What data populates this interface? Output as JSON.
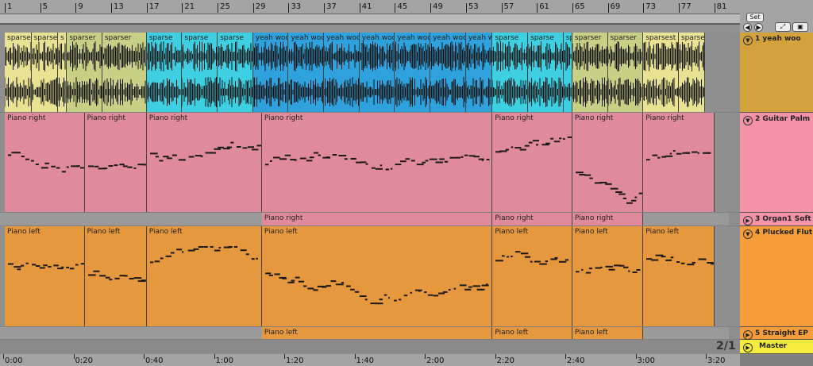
{
  "ruler": {
    "bars": [
      "1",
      "5",
      "9",
      "13",
      "17",
      "21",
      "25",
      "29",
      "33",
      "37",
      "41",
      "45",
      "49",
      "53",
      "57",
      "61",
      "65",
      "69",
      "73",
      "77",
      "81"
    ]
  },
  "set_button": "Set",
  "tracks": [
    {
      "number": "1",
      "name": "yeah woo",
      "color": "#d4a23a",
      "clips": [
        {
          "label": "sparsest",
          "color": "#e9e293",
          "start": 0,
          "end": 3
        },
        {
          "label": "sparsest",
          "color": "#e9e293",
          "start": 3,
          "end": 6
        },
        {
          "label": "s",
          "color": "#e9e293",
          "start": 6,
          "end": 7
        },
        {
          "label": "sparser",
          "color": "#c8d086",
          "start": 7,
          "end": 11
        },
        {
          "label": "sparser",
          "color": "#c8d086",
          "start": 11,
          "end": 16
        },
        {
          "label": "sparse",
          "color": "#3ed0e2",
          "start": 16,
          "end": 20
        },
        {
          "label": "sparse",
          "color": "#3ed0e2",
          "start": 20,
          "end": 24
        },
        {
          "label": "sparse",
          "color": "#3ed0e2",
          "start": 24,
          "end": 28
        },
        {
          "label": "yeah woo",
          "color": "#2fa2dd",
          "start": 28,
          "end": 32
        },
        {
          "label": "yeah woo",
          "color": "#2fa2dd",
          "start": 32,
          "end": 36
        },
        {
          "label": "yeah woo",
          "color": "#2fa2dd",
          "start": 36,
          "end": 40
        },
        {
          "label": "yeah woo",
          "color": "#2fa2dd",
          "start": 40,
          "end": 44
        },
        {
          "label": "yeah woo",
          "color": "#2fa2dd",
          "start": 44,
          "end": 48
        },
        {
          "label": "yeah woo",
          "color": "#2fa2dd",
          "start": 48,
          "end": 52
        },
        {
          "label": "yeah wo",
          "color": "#2fa2dd",
          "start": 52,
          "end": 55
        },
        {
          "label": "sparse",
          "color": "#3ed0e2",
          "start": 55,
          "end": 59
        },
        {
          "label": "sparse",
          "color": "#3ed0e2",
          "start": 59,
          "end": 63
        },
        {
          "label": "sp",
          "color": "#3ed0e2",
          "start": 63,
          "end": 64
        },
        {
          "label": "sparser",
          "color": "#c8d086",
          "start": 64,
          "end": 68
        },
        {
          "label": "sparser",
          "color": "#c8d086",
          "start": 68,
          "end": 72
        },
        {
          "label": "sparsest",
          "color": "#e9e293",
          "start": 72,
          "end": 76
        },
        {
          "label": "sparses",
          "color": "#e9e293",
          "start": 76,
          "end": 79
        }
      ]
    },
    {
      "number": "2",
      "name": "Guitar Palm",
      "color": "#f493a8",
      "clips": [
        {
          "label": "Piano right",
          "color": "#e08b9c",
          "start": 0,
          "end": 9
        },
        {
          "label": "Piano right",
          "color": "#e08b9c",
          "start": 9,
          "end": 16
        },
        {
          "label": "Piano right",
          "color": "#e08b9c",
          "start": 16,
          "end": 29
        },
        {
          "label": "Piano right",
          "color": "#e08b9c",
          "start": 29,
          "end": 55
        },
        {
          "label": "Piano right",
          "color": "#e08b9c",
          "start": 55,
          "end": 64
        },
        {
          "label": "Piano right",
          "color": "#e08b9c",
          "start": 64,
          "end": 72
        },
        {
          "label": "Piano right",
          "color": "#e08b9c",
          "start": 72,
          "end": 80
        }
      ]
    },
    {
      "number": "3",
      "name": "Organ1 Soft",
      "color": "#f493a8",
      "clips": [
        {
          "label": "Piano right",
          "color": "#e08b9c",
          "start": 29,
          "end": 55
        },
        {
          "label": "Piano right",
          "color": "#e08b9c",
          "start": 55,
          "end": 64
        },
        {
          "label": "Piano right",
          "color": "#e08b9c",
          "start": 64,
          "end": 72
        }
      ]
    },
    {
      "number": "4",
      "name": "Plucked Flut",
      "color": "#f59d38",
      "clips": [
        {
          "label": "Piano left",
          "color": "#e5983e",
          "start": 0,
          "end": 9
        },
        {
          "label": "Piano left",
          "color": "#e5983e",
          "start": 9,
          "end": 16
        },
        {
          "label": "Piano left",
          "color": "#e5983e",
          "start": 16,
          "end": 29
        },
        {
          "label": "Piano left",
          "color": "#e5983e",
          "start": 29,
          "end": 55
        },
        {
          "label": "Piano left",
          "color": "#e5983e",
          "start": 55,
          "end": 64
        },
        {
          "label": "Piano left",
          "color": "#e5983e",
          "start": 64,
          "end": 72
        },
        {
          "label": "Piano left",
          "color": "#e5983e",
          "start": 72,
          "end": 80
        }
      ]
    },
    {
      "number": "5",
      "name": "Straight EP",
      "color": "#f59d38",
      "clips": [
        {
          "label": "Piano left",
          "color": "#e5983e",
          "start": 29,
          "end": 55
        },
        {
          "label": "Piano left",
          "color": "#e5983e",
          "start": 55,
          "end": 64
        },
        {
          "label": "Piano left",
          "color": "#e5983e",
          "start": 64,
          "end": 72
        }
      ]
    }
  ],
  "master": {
    "name": "Master",
    "color": "#f7ec3d"
  },
  "time_ruler": {
    "labels": [
      "0:00",
      "0:20",
      "0:40",
      "1:00",
      "1:20",
      "1:40",
      "2:00",
      "2:20",
      "2:40",
      "3:00",
      "3:20"
    ]
  },
  "counter": "2/1"
}
